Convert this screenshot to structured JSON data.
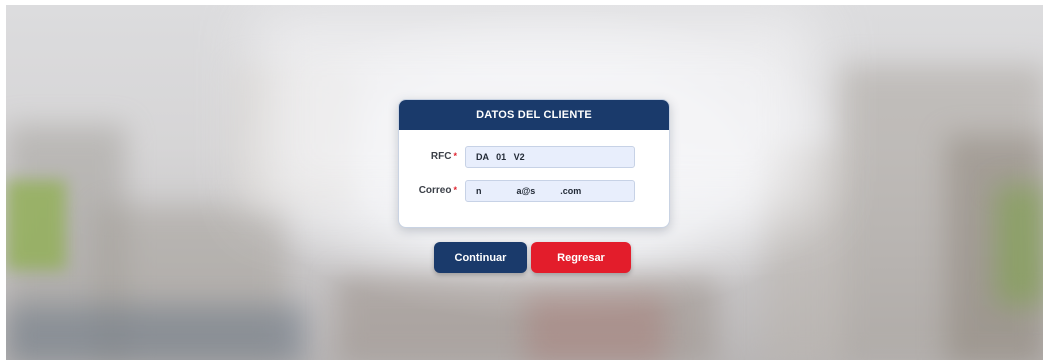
{
  "card": {
    "title": "DATOS DEL CLIENTE"
  },
  "form": {
    "rfc": {
      "label": "RFC",
      "required_mark": "*",
      "value": "DA   01   V2"
    },
    "correo": {
      "label": "Correo",
      "required_mark": "*",
      "value": "n              a@s          .com"
    }
  },
  "buttons": {
    "continue_label": "Continuar",
    "back_label": "Regresar"
  },
  "colors": {
    "header": "#1a3a6b",
    "primary_button": "#1a3a6b",
    "secondary_button": "#e31d2b",
    "required_mark": "#e0232f",
    "input_background": "#e8eefc"
  }
}
